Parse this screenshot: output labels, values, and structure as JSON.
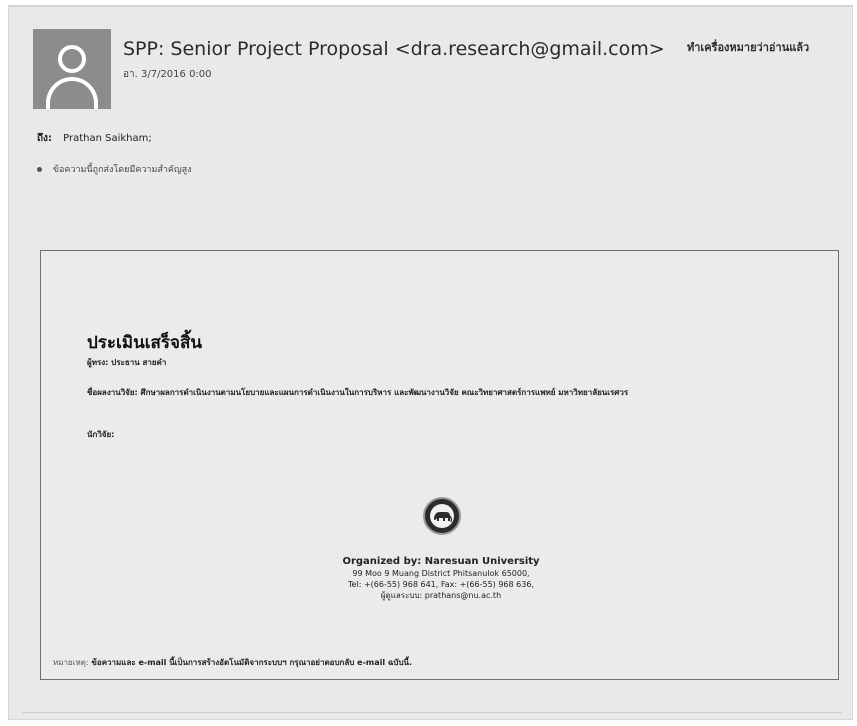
{
  "header": {
    "subject": "SPP: Senior Project Proposal <dra.research@gmail.com>",
    "date": "อา. 3/7/2016 0:00",
    "mark_read": "ทำเครื่องหมายว่าอ่านแล้ว"
  },
  "recipients": {
    "to_label": "ถึง:",
    "to_value": "Prathan Saikham;"
  },
  "importance": {
    "text": "ข้อความนี้ถูกส่งโดยมีความสำคัญสูง"
  },
  "message": {
    "title": "ประเมินเสร็จสิ้น",
    "responsible": "ผู้ทรง: ประธาน สายคำ",
    "project": "ชื่อผลงานวิจัย: ศึกษาผลการดำเนินงานตามนโยบายและแผนการดำเนินงานในการบริหาร และพัฒนางานวิจัย คณะวิทยาศาสตร์การแพทย์ มหาวิทยาลัยนเรศวร",
    "researcher": "นักวิจัย:",
    "org_name": "Organized by: Naresuan University",
    "org_address": "99 Moo 9 Muang District Phitsanulok 65000,",
    "org_phone": "Tel: +(66-55) 968 641, Fax: +(66-55) 968 636,",
    "org_admin": "ผู้ดูแลระบบ: prathans@nu.ac.th",
    "disclaimer_label": "หมายเหตุ:",
    "disclaimer_text": "ข้อความและ e-mail นี้เป็นการสร้างอัตโนมัติจากระบบฯ กรุณาอย่าตอบกลับ e-mail ฉบับนี้."
  },
  "icons": {
    "avatar": "person-silhouette-icon",
    "seal": "university-seal-elephant-icon",
    "importance": "info-dot-icon"
  },
  "colors": {
    "window_bg": "#e9e9e9",
    "avatar_bg": "#8c8c8c",
    "message_border": "#6f6f6f"
  }
}
